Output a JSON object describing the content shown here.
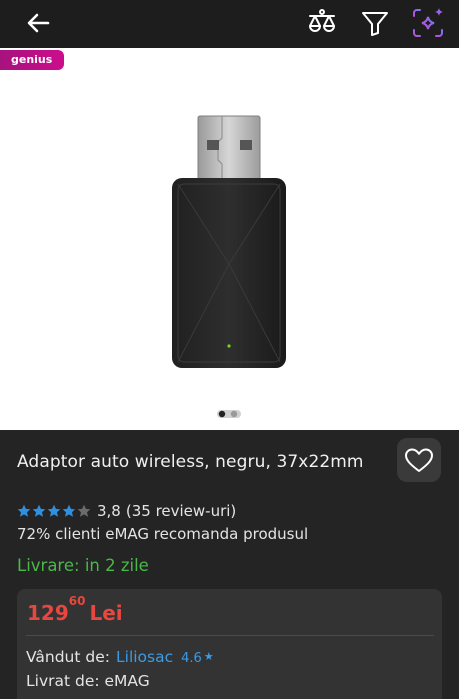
{
  "badge": {
    "label": "genius"
  },
  "product": {
    "title": "Adaptor auto wireless, negru, 37x22mm",
    "rating_value": "3,8",
    "reviews": "(35 review-uri)",
    "stars": 3.8,
    "recommend": "72% clienti eMAG recomanda produsul",
    "delivery": "Livrare: in 2 zile",
    "image_count": 2,
    "active_image": 1
  },
  "offer": {
    "price_int": "129",
    "price_dec": "60",
    "currency": "Lei",
    "sold_by_label": "Vândut de:",
    "seller": "Liliosac",
    "seller_rating": "4.6",
    "shipped_by": "Livrat de: eMAG"
  },
  "icons": {
    "back": "arrow-left-icon",
    "compare": "compare-scale-icon",
    "filter": "filter-icon",
    "ai": "sparkle-search-icon",
    "favorite": "heart-icon"
  },
  "colors": {
    "price": "#e8473f",
    "delivery": "#4ab84a",
    "link": "#3a9be6",
    "star": "#2f8fe0",
    "badge": "#b5117f"
  }
}
